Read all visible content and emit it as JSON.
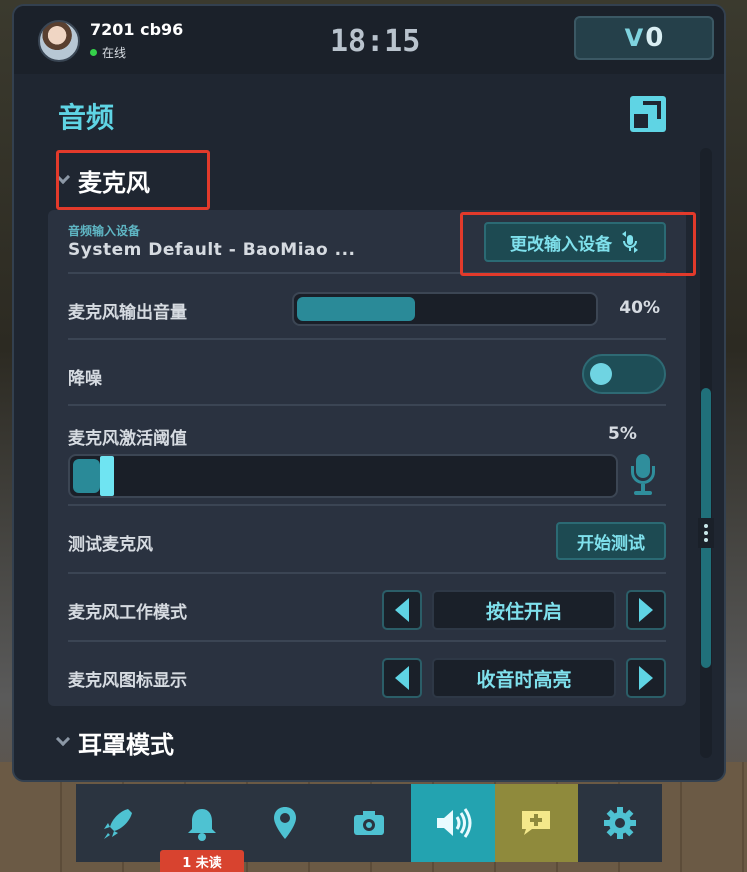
{
  "user": {
    "name": "7201 cb96",
    "status": "在线"
  },
  "clock": "18:15",
  "credits": {
    "prefix": "V",
    "amount": "0"
  },
  "page": {
    "title": "音频"
  },
  "microphone": {
    "heading": "麦克风",
    "input_device": {
      "label": "音频输入设备",
      "value": "System Default - BaoMiao ...",
      "change_button": "更改输入设备"
    },
    "output_volume": {
      "label": "麦克风输出音量",
      "value": 40,
      "display": "40%"
    },
    "noise_reduction": {
      "label": "降噪",
      "enabled": false
    },
    "activation_threshold": {
      "label": "麦克风激活阈值",
      "value": 5,
      "display": "5%"
    },
    "test": {
      "label": "测试麦克风",
      "button": "开始测试"
    },
    "mode": {
      "label": "麦克风工作模式",
      "value": "按住开启"
    },
    "icon_display": {
      "label": "麦克风图标显示",
      "value": "收音时高亮"
    }
  },
  "headset_mode": {
    "heading": "耳罩模式"
  },
  "dock": {
    "items": [
      {
        "icon": "rocket-icon"
      },
      {
        "icon": "bell-icon"
      },
      {
        "icon": "map-pin-icon"
      },
      {
        "icon": "camera-icon"
      },
      {
        "icon": "speaker-icon",
        "active": true
      },
      {
        "icon": "chat-add-icon"
      },
      {
        "icon": "gear-icon"
      }
    ],
    "notification_badge": "1 未读"
  },
  "colors": {
    "accent": "#5fd4e4",
    "highlight": "#e23a2b",
    "active_tab": "#23a3b0"
  }
}
